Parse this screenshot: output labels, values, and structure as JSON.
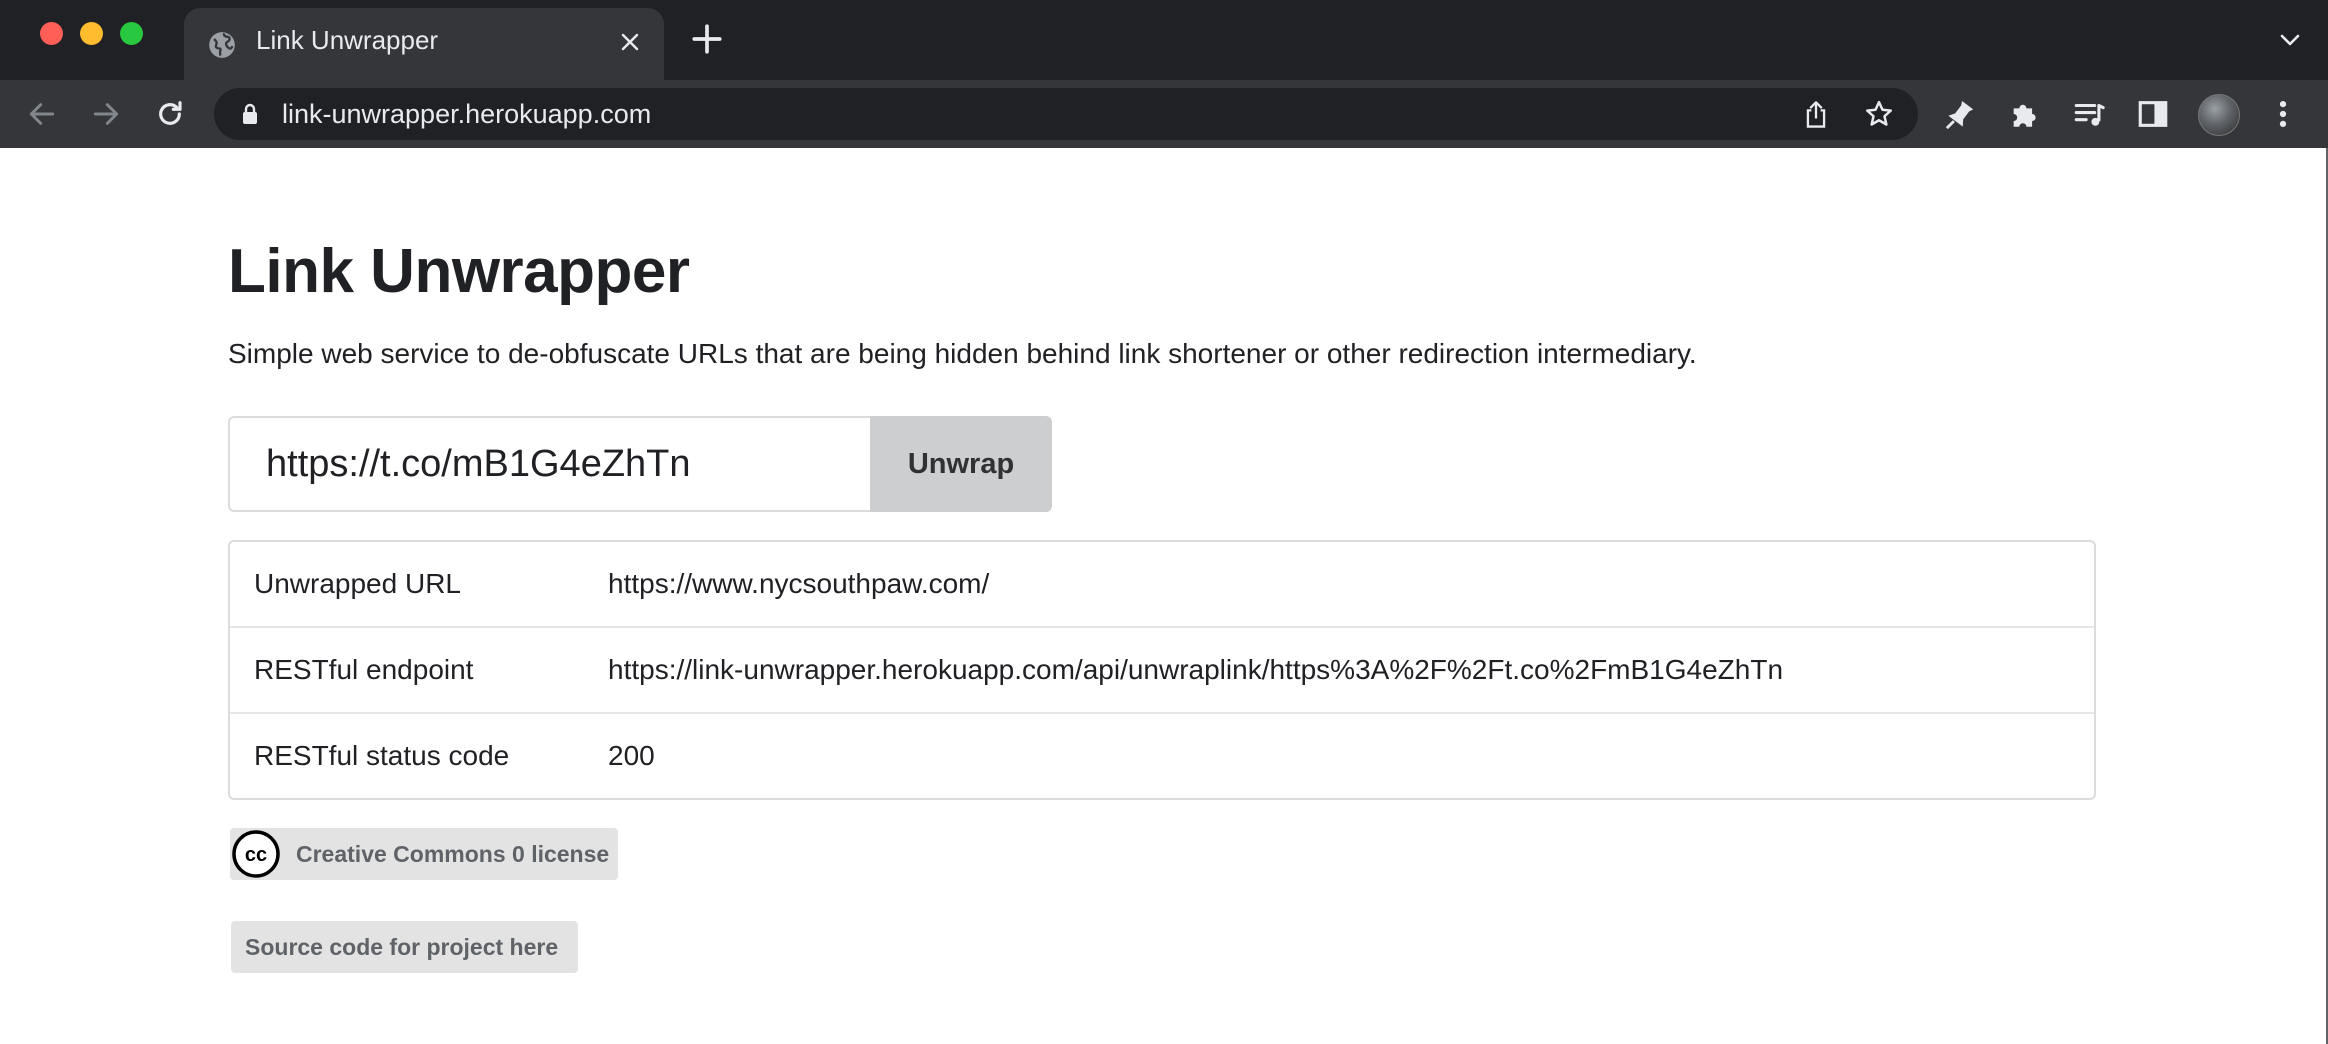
{
  "browser": {
    "tab_title": "Link Unwrapper",
    "address": "link-unwrapper.herokuapp.com"
  },
  "page": {
    "title": "Link Unwrapper",
    "description": "Simple web service to de-obfuscate URLs that are being hidden behind link shortener or other redirection intermediary.",
    "input_value": "https://t.co/mB1G4eZhTn",
    "unwrap_label": "Unwrap",
    "results": [
      {
        "label": "Unwrapped URL",
        "value": "https://www.nycsouthpaw.com/"
      },
      {
        "label": "RESTful endpoint",
        "value": "https://link-unwrapper.herokuapp.com/api/unwraplink/https%3A%2F%2Ft.co%2FmB1G4eZhTn"
      },
      {
        "label": "RESTful status code",
        "value": "200"
      }
    ],
    "license_label": "Creative Commons 0 license",
    "source_label": "Source code for project here"
  },
  "colors": {
    "chrome_dark": "#202124",
    "chrome_toolbar": "#35363a",
    "button_bg": "#cdced0",
    "badge_bg": "#e3e3e4"
  },
  "icons": [
    "globe-icon",
    "close-icon",
    "plus-icon",
    "chevron-down-icon",
    "back-arrow-icon",
    "forward-arrow-icon",
    "reload-icon",
    "lock-icon",
    "share-icon",
    "star-icon",
    "pin-icon",
    "puzzle-icon",
    "media-icon",
    "sidepanel-icon",
    "avatar",
    "kebab-menu-icon",
    "creative-commons-icon"
  ]
}
